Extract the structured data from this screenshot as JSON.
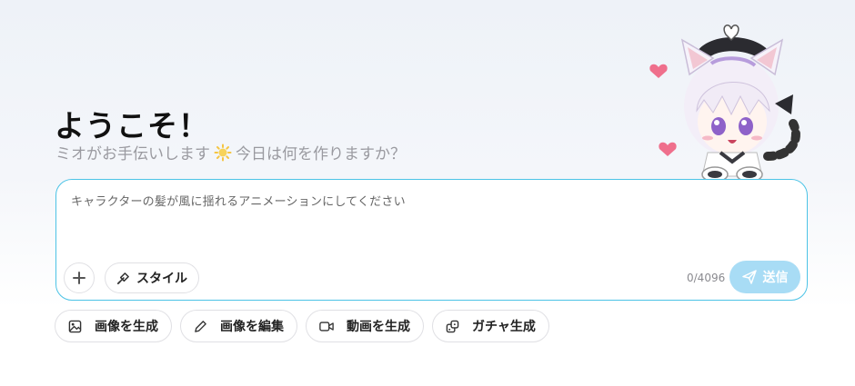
{
  "welcome": {
    "heading": "ようこそ！",
    "subtitle_before": "ミオがお手伝いします",
    "subtitle_after": "今日は何を作りますか？",
    "sun_icon": "sun-emoji-icon"
  },
  "mascot": {
    "icon": "catgirl-mascot-icon"
  },
  "composer": {
    "prompt_text": "キャラクターの髪が風に揺れるアニメーションにしてください",
    "add_icon": "plus-icon",
    "style_label": "スタイル",
    "style_icon": "paintbrush-icon",
    "char_count": "0/4096",
    "send_label": "送信",
    "send_icon": "paper-plane-icon",
    "accent_color": "#4cc3e6",
    "send_color": "#a8dcf5"
  },
  "actions": [
    {
      "label": "画像を生成",
      "icon": "image-icon"
    },
    {
      "label": "画像を編集",
      "icon": "pencil-icon"
    },
    {
      "label": "動画を生成",
      "icon": "video-camera-icon"
    },
    {
      "label": "ガチャ生成",
      "icon": "gacha-dice-icon"
    }
  ]
}
